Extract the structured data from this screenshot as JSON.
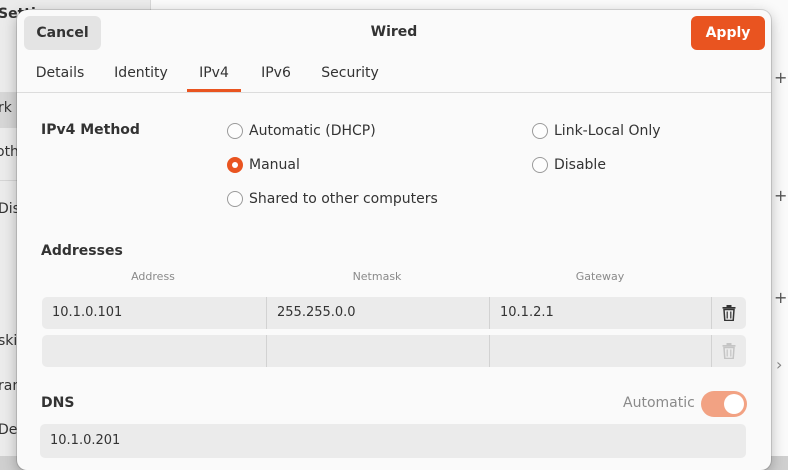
{
  "background": {
    "sidebar_fragments": [
      "Setti",
      "rk",
      "oth",
      "Dis",
      "ski",
      "ran",
      "De"
    ],
    "right_glyphs": [
      "+",
      "+",
      "+"
    ]
  },
  "dialog": {
    "title": "Wired",
    "cancel_label": "Cancel",
    "apply_label": "Apply",
    "tabs": [
      {
        "label": "Details",
        "active": false
      },
      {
        "label": "Identity",
        "active": false
      },
      {
        "label": "IPv4",
        "active": true
      },
      {
        "label": "IPv6",
        "active": false
      },
      {
        "label": "Security",
        "active": false
      }
    ],
    "ipv4_method": {
      "label": "IPv4 Method",
      "options": [
        {
          "label": "Automatic (DHCP)",
          "checked": false
        },
        {
          "label": "Link-Local Only",
          "checked": false
        },
        {
          "label": "Manual",
          "checked": true
        },
        {
          "label": "Disable",
          "checked": false
        },
        {
          "label": "Shared to other computers",
          "checked": false
        }
      ]
    },
    "addresses": {
      "label": "Addresses",
      "columns": [
        "Address",
        "Netmask",
        "Gateway"
      ],
      "rows": [
        [
          "10.1.0.101",
          "255.255.0.0",
          "10.1.2.1"
        ],
        [
          "",
          "",
          ""
        ]
      ]
    },
    "dns": {
      "label": "DNS",
      "automatic_label": "Automatic",
      "automatic_on": true,
      "value": "10.1.0.201"
    }
  },
  "colors": {
    "accent": "#e95420",
    "toggle_on": "#f2a283"
  }
}
